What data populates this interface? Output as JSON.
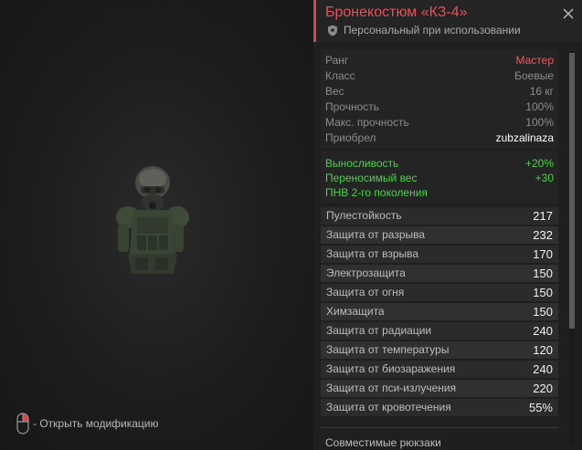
{
  "item": {
    "title": "Бронекостюм «КЗ-4»",
    "binding": "Персональный при использовании"
  },
  "info": [
    {
      "key": "Ранг",
      "value": "Мастер"
    },
    {
      "key": "Класс",
      "value": "Боевые"
    },
    {
      "key": "Вес",
      "value": "16 кг"
    },
    {
      "key": "Прочность",
      "value": "100%"
    },
    {
      "key": "Макс. прочность",
      "value": "100%"
    },
    {
      "key": "Приобрел",
      "value": "zubzalinaza"
    }
  ],
  "bonuses": [
    {
      "key": "Выносливость",
      "value": "+20%"
    },
    {
      "key": "Переносимый вес",
      "value": "+30"
    },
    {
      "key": "ПНВ 2-го поколения",
      "value": ""
    }
  ],
  "stats": [
    {
      "key": "Пулестойкость",
      "value": "217"
    },
    {
      "key": "Защита от разрыва",
      "value": "232"
    },
    {
      "key": "Защита от взрыва",
      "value": "170"
    },
    {
      "key": "Электрозащита",
      "value": "150"
    },
    {
      "key": "Защита от огня",
      "value": "150"
    },
    {
      "key": "Химзащита",
      "value": "150"
    },
    {
      "key": "Защита от радиации",
      "value": "240"
    },
    {
      "key": "Защита от температуры",
      "value": "120"
    },
    {
      "key": "Защита от биозаражения",
      "value": "240"
    },
    {
      "key": "Защита от пси-излучения",
      "value": "220"
    },
    {
      "key": "Защита от кровотечения",
      "value": "55%"
    }
  ],
  "backpacks_label": "Совместимые рюкзаки",
  "hint": "- Открыть модификацию",
  "icons": {
    "close": "close-icon",
    "shield": "shield-icon",
    "mouse": "mouse-icon"
  },
  "colors": {
    "accent": "#e0434e",
    "bonus": "#4cd24c"
  }
}
